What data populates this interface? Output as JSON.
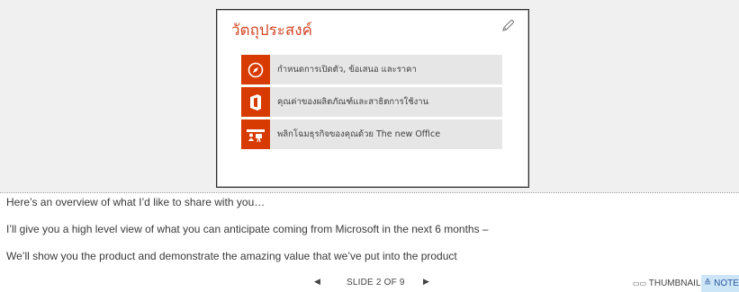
{
  "slide": {
    "title": "วัตถุประสงค์",
    "items": [
      {
        "icon": "compass-icon",
        "label": "กำหนดการเปิดตัว, ข้อเสนอ และราคา"
      },
      {
        "icon": "office-icon",
        "label": "คุณค่าของผลิตภัณฑ์และสาธิตการใช้งาน"
      },
      {
        "icon": "collaboration-icon",
        "label": "พลิกโฉมธุรกิจของคุณด้วย The new Office"
      }
    ],
    "accent_color": "#d83b01"
  },
  "notes": {
    "lines": [
      "Here’s an overview of what I’d like to share with you…",
      "I’ll give you a high level view of what you can anticipate coming from Microsoft in the next 6 months –",
      "We’ll show you the product and demonstrate the amazing value that we’ve put into the product"
    ]
  },
  "navigation": {
    "counter": "SLIDE 2 OF 9",
    "thumbnails_label": "THUMBNAILS",
    "notes_label": "NOTES"
  }
}
